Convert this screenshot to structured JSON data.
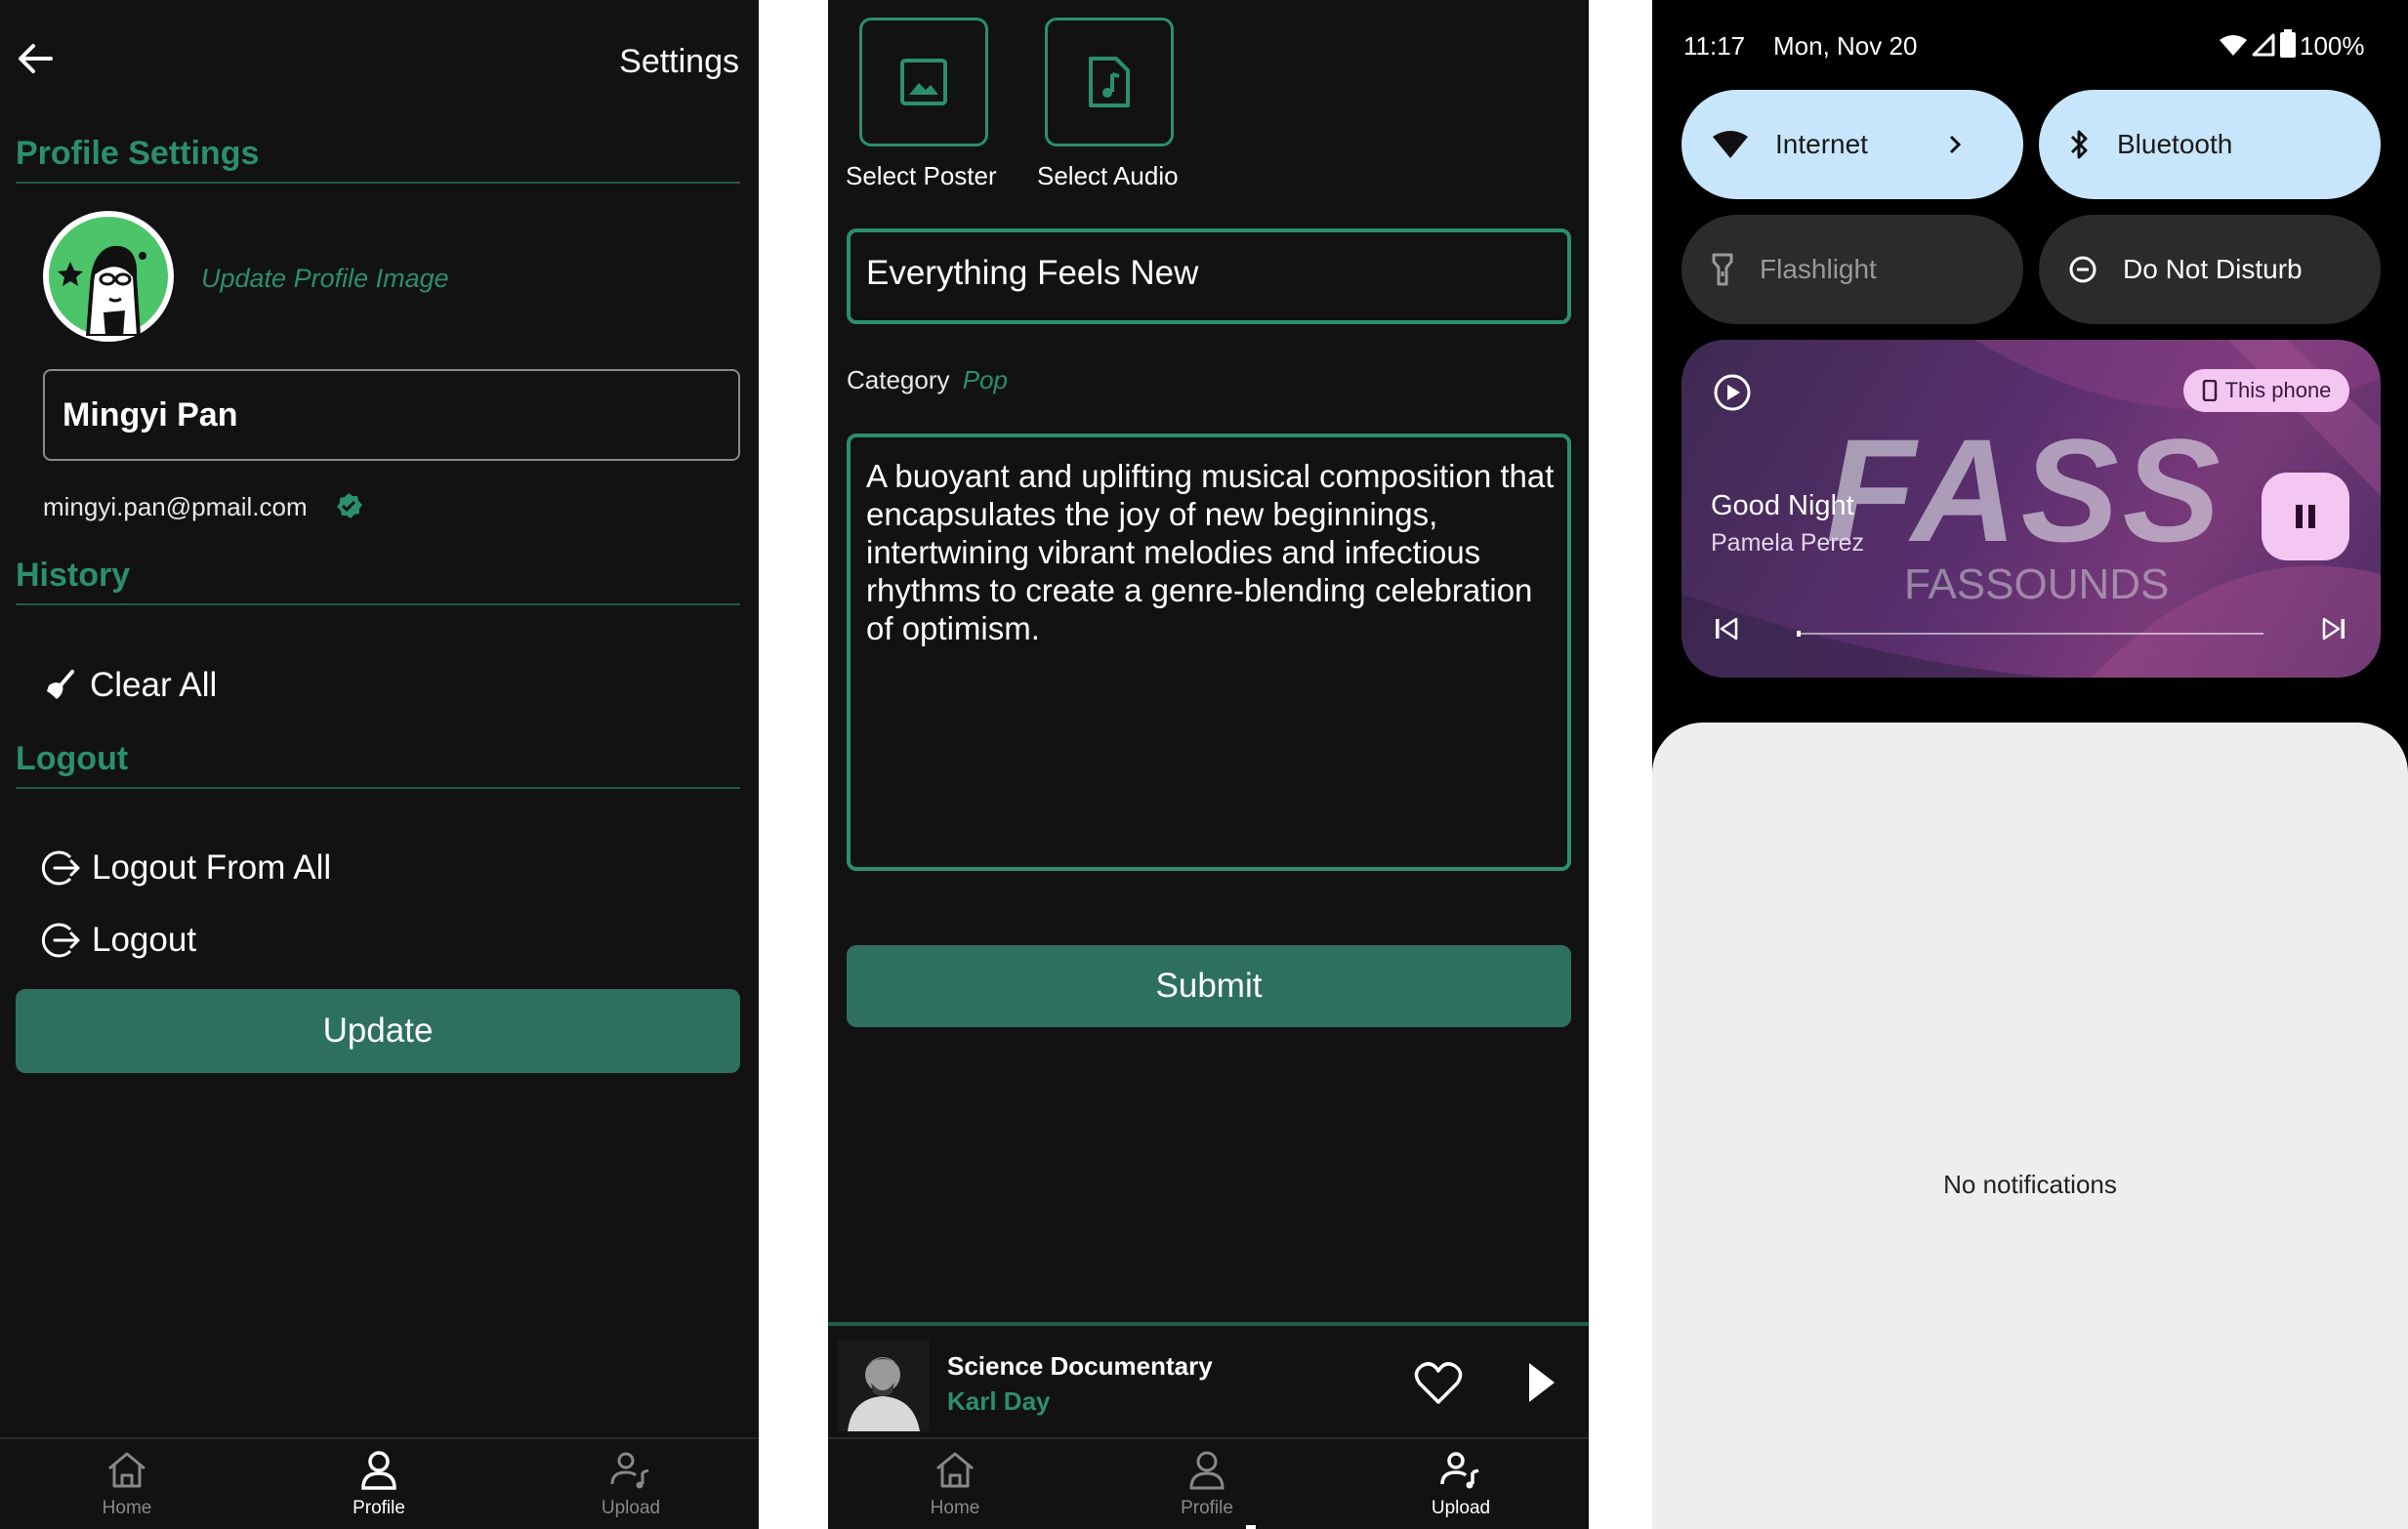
{
  "settings": {
    "title": "Settings",
    "profile_section": "Profile Settings",
    "update_image": "Update Profile Image",
    "name_value": "Mingyi Pan",
    "email": "mingyi.pan@pmail.com",
    "history_section": "History",
    "clear_all": "Clear All",
    "logout_section": "Logout",
    "logout_all": "Logout From All",
    "logout": "Logout",
    "update_button": "Update"
  },
  "upload": {
    "select_poster": "Select Poster",
    "select_audio": "Select Audio",
    "title_value": "Everything Feels New",
    "category_label": "Category",
    "category_value": "Pop",
    "description_value": "A buoyant and uplifting musical composition that encapsulates the joy of new beginnings, intertwining vibrant melodies and infectious rhythms to create a genre-blending celebration of optimism.",
    "submit_button": "Submit"
  },
  "mini_player": {
    "title": "Science Documentary",
    "artist": "Karl Day"
  },
  "nav": {
    "home": "Home",
    "profile": "Profile",
    "upload": "Upload"
  },
  "quick_settings": {
    "time": "11:17",
    "date": "Mon, Nov 20",
    "battery": "100%",
    "tiles": {
      "internet": "Internet",
      "bluetooth": "Bluetooth",
      "flashlight": "Flashlight",
      "dnd": "Do Not Disturb"
    },
    "media": {
      "output": "This phone",
      "title": "Good Night",
      "artist": "Pamela Perez",
      "art_text": "FASS",
      "art_subtext": "FASSOUNDS"
    },
    "no_notifications": "No notifications"
  },
  "colors": {
    "accent": "#2b8f6e",
    "button": "#2d7060",
    "tile_active": "#c8e6fb",
    "tile_inactive": "#2b2b2b",
    "media_chip": "#f4c6f2"
  }
}
